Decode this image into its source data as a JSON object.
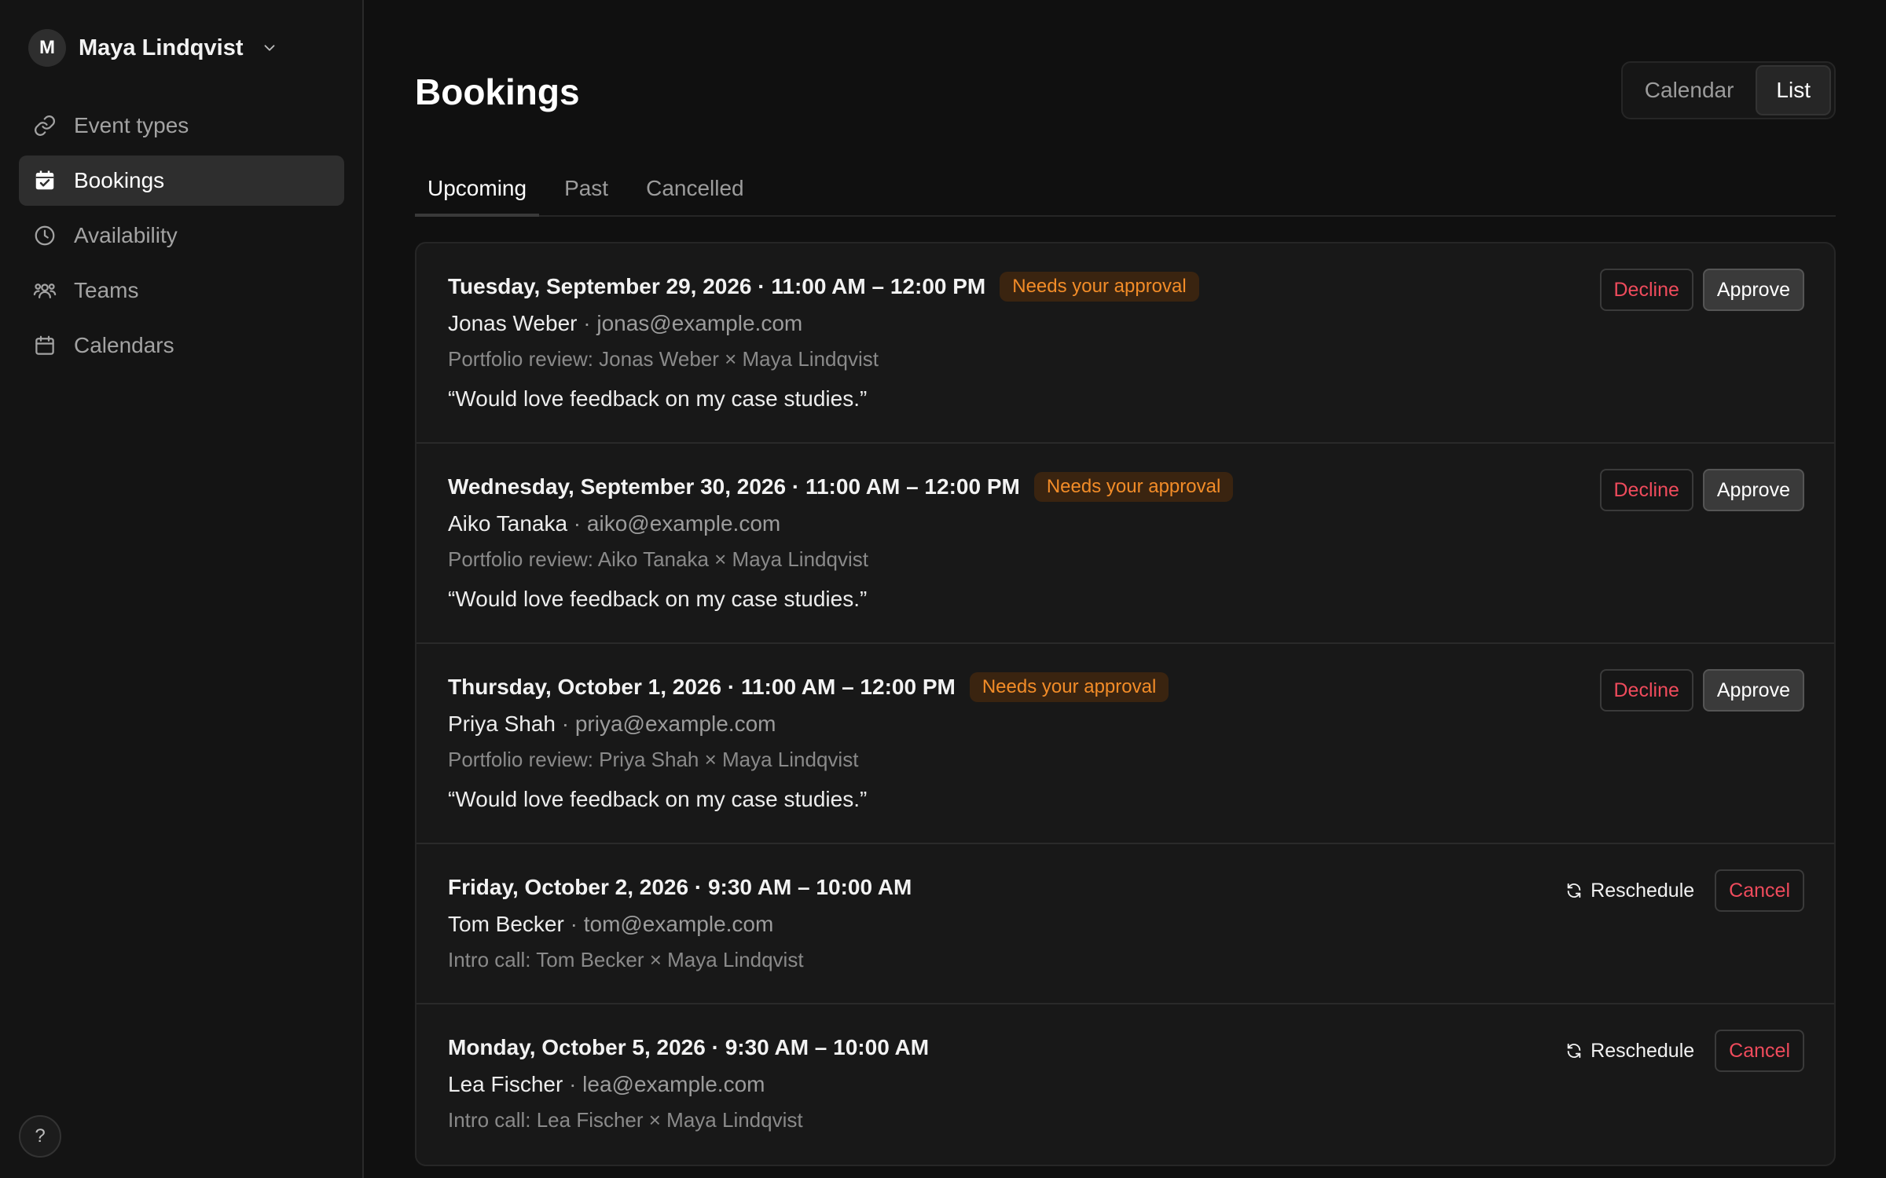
{
  "user": {
    "initial": "M",
    "name": "Maya Lindqvist"
  },
  "sidebar": {
    "items": [
      {
        "label": "Event types",
        "icon": "link-icon"
      },
      {
        "label": "Bookings",
        "icon": "calendar-check-icon",
        "active": true
      },
      {
        "label": "Availability",
        "icon": "clock-icon"
      },
      {
        "label": "Teams",
        "icon": "users-icon"
      },
      {
        "label": "Calendars",
        "icon": "calendar-icon"
      }
    ],
    "help_label": "?"
  },
  "main": {
    "title": "Bookings",
    "view_toggle": {
      "calendar": "Calendar",
      "list": "List",
      "active": "List"
    },
    "tabs": [
      {
        "label": "Upcoming",
        "active": true
      },
      {
        "label": "Past"
      },
      {
        "label": "Cancelled"
      }
    ]
  },
  "bookings": [
    {
      "when": "Tuesday, September 29, 2026 · 11:00 AM – 12:00 PM",
      "badge": "Needs your approval",
      "name": "Jonas Weber",
      "email": " · jonas@example.com",
      "event": "Portfolio review: Jonas Weber × Maya Lindqvist",
      "note": "“Would love feedback on my case studies.”",
      "decline": "Decline",
      "approve": "Approve"
    },
    {
      "when": "Wednesday, September 30, 2026 · 11:00 AM – 12:00 PM",
      "badge": "Needs your approval",
      "name": "Aiko Tanaka",
      "email": " · aiko@example.com",
      "event": "Portfolio review: Aiko Tanaka × Maya Lindqvist",
      "note": "“Would love feedback on my case studies.”",
      "decline": "Decline",
      "approve": "Approve"
    },
    {
      "when": "Thursday, October 1, 2026 · 11:00 AM – 12:00 PM",
      "badge": "Needs your approval",
      "name": "Priya Shah",
      "email": " · priya@example.com",
      "event": "Portfolio review: Priya Shah × Maya Lindqvist",
      "note": "“Would love feedback on my case studies.”",
      "decline": "Decline",
      "approve": "Approve"
    },
    {
      "when": "Friday, October 2, 2026 · 9:30 AM – 10:00 AM",
      "name": "Tom Becker",
      "email": " · tom@example.com",
      "event": "Intro call: Tom Becker × Maya Lindqvist",
      "reschedule": "Reschedule",
      "cancel": "Cancel"
    },
    {
      "when": "Monday, October 5, 2026 · 9:30 AM – 10:00 AM",
      "name": "Lea Fischer",
      "email": " · lea@example.com",
      "event": "Intro call: Lea Fischer × Maya Lindqvist",
      "reschedule": "Reschedule",
      "cancel": "Cancel"
    }
  ],
  "colors": {
    "background": "#101010",
    "badge_text": "#f28c28",
    "badge_bg": "#3a2410",
    "danger": "#ef4b5c"
  }
}
